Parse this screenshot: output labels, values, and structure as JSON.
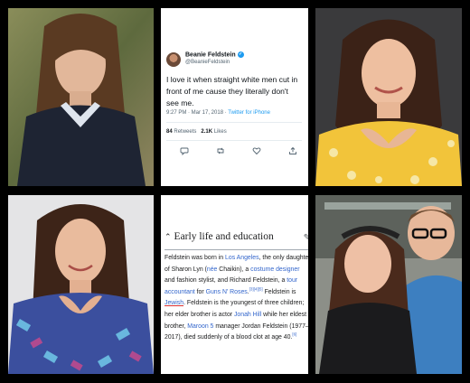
{
  "colors": {
    "background": "#000000",
    "link": "#3366cc",
    "twitter_blue": "#1d9bf0",
    "muted": "#536471"
  },
  "tweet": {
    "display_name": "Beanie Feldstein",
    "handle": "@BeanieFeldstein",
    "text": "I love it when straight white men cut in front of me cause they literally don't see me.",
    "time": "9:27 PM · Mar 17, 2018 · ",
    "source": "Twitter for iPhone",
    "retweets_count": "84",
    "retweets_label": " Retweets   ",
    "likes_count": "2.1K",
    "likes_label": " Likes",
    "action_icons": [
      "reply-icon",
      "retweet-icon",
      "like-icon",
      "share-icon"
    ]
  },
  "wiki": {
    "heading": "Early life and education",
    "body": {
      "p1": "Feldstein was born in ",
      "l1": "Los Angeles",
      "p2": ", the only daughter of Sharon Lyn (",
      "l2": "née",
      "p3": " Chaikin), a ",
      "l3": "costume designer",
      "p4": " and fashion stylist, and Richard Feldstein, a ",
      "l4": "tour accountant",
      "p5": " for ",
      "l5": "Guns N' Roses",
      "p6": ".",
      "s1": "[3][4][5]",
      "p7": " Feldstein is ",
      "l6": "Jewish",
      "p8": ". Feldstein is the youngest of three children; her elder brother is actor ",
      "l7": "Jonah Hill",
      "p9": " while her eldest brother, ",
      "l8": "Maroon 5",
      "p10": " manager Jordan Feldstein (1977–2017), died suddenly of a blood clot at age 40.",
      "s2": "[6]"
    }
  },
  "photos": [
    {
      "name": "photo-top-left"
    },
    {
      "name": "photo-top-right"
    },
    {
      "name": "photo-bottom-left"
    },
    {
      "name": "photo-bottom-right"
    }
  ]
}
